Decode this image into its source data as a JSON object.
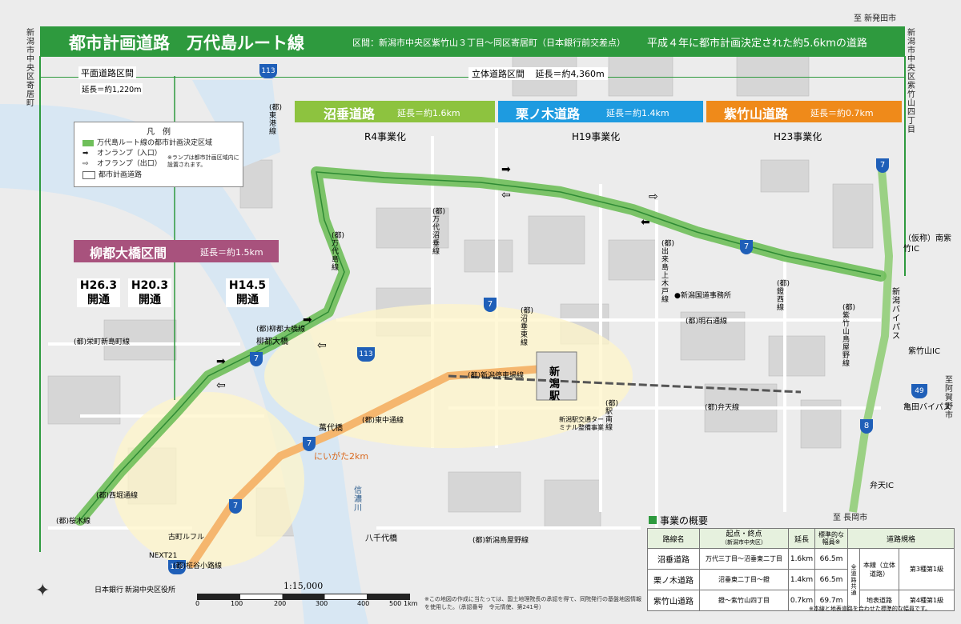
{
  "header": {
    "title": "都市計画道路　万代島ルート線",
    "section": "区間：新潟市中央区紫竹山３丁目〜同区寄居町（日本銀行前交差点）",
    "summary": "平成４年に都市計画決定された約5.6kmの道路"
  },
  "edges": {
    "left_top": "新潟市中央区寄居町",
    "right_top": "新潟市中央区紫竹山四丁目",
    "north_right": "至 新発田市",
    "south_exit": "至 長岡市",
    "east_exit": "至 阿賀野市"
  },
  "intervals": {
    "flat_label": "平面道路区間",
    "flat_length": "延長＝約1,220m",
    "elevated_label": "立体道路区間",
    "elevated_length": "延長＝約4,360m"
  },
  "sections": [
    {
      "name": "沼垂道路",
      "length": "延長＝約1.6km",
      "year": "R4事業化",
      "color": "#8dc33f"
    },
    {
      "name": "栗ノ木道路",
      "length": "延長＝約1.4km",
      "year": "H19事業化",
      "color": "#1e9be0"
    },
    {
      "name": "紫竹山道路",
      "length": "延長＝約0.7km",
      "year": "H23事業化",
      "color": "#ef8a1a"
    }
  ],
  "yanagi": {
    "name": "柳都大橋区間",
    "length": "延長＝約1.5km",
    "openings": [
      {
        "year": "H26.3",
        "status": "開通"
      },
      {
        "year": "H20.3",
        "status": "開通"
      },
      {
        "year": "H14.5",
        "status": "開通"
      }
    ]
  },
  "legend": {
    "title": "凡　例",
    "items": [
      "万代島ルート線の都市計画決定区域",
      "オンランプ（入口）",
      "オフランプ（出口）",
      "都市計画道路"
    ],
    "note": "※ランプは都市計画区域内に設置されます。"
  },
  "ics": [
    "（仮称）南紫竹IC",
    "紫竹山IC",
    "弁天IC"
  ],
  "places": {
    "station": "新潟駅",
    "river": "信濃川",
    "bridge_yachiyo": "八千代橋",
    "bridge_bandai": "萬代橋",
    "niigata2km": "にいがた2km",
    "bandai_bridge_label": "柳都大橋",
    "bypass_niigata": "新潟バイパス",
    "bypass_kameda": "亀田バイパス",
    "terminal": "新潟駅交通ターミナル整備事業",
    "office": "●新潟国道事務所",
    "nextz": "NEXT21",
    "furumachi": "古町ルフル",
    "bank": "日本銀行",
    "city_hall": "新潟中央区役所"
  },
  "roads": [
    "(都)東港線",
    "(都)万代沼垂線",
    "(都)沼垂東線",
    "(都)出来島上木戸線",
    "(都)明石通線",
    "(都)新潟停車場線",
    "(都)弁天線",
    "(都)柳都大橋線",
    "(都)東中通線",
    "(都)西堀通線",
    "(都)柾谷小路線",
    "(都)新潟鳥屋野線",
    "(都)駅南線",
    "(都)桜木線",
    "(都)万代島線",
    "(都)栄町新島町線",
    "(都)紫竹山鳥屋野線",
    "(都)鐙西線"
  ],
  "route_numbers": [
    "7",
    "113",
    "116",
    "8",
    "49"
  ],
  "scale": {
    "ratio": "1:15,000",
    "ticks": [
      "0",
      "100",
      "200",
      "300",
      "400",
      "500",
      "1km"
    ]
  },
  "credit": "※この地図の作成に当たっては、国土地理院長の承認を得て、同院発行の基盤地図情報を使用した。（承認番号　令元情使、第241号）",
  "overview": {
    "title": "事業の概要",
    "headers": [
      "路線名",
      "起点・終点",
      "延長",
      "標準的な幅員※",
      "道路規格"
    ],
    "start_end_sub": "（新潟市中央区）",
    "shared": "全道路共通",
    "rows": [
      {
        "name": "沼垂道路",
        "range": "万代三丁目〜沼垂東二丁目",
        "length": "1.6km",
        "width": "66.5m",
        "spec_kind": "本線（立体道路）",
        "spec_grade": "第3種第1級"
      },
      {
        "name": "栗ノ木道路",
        "range": "沼垂東二丁目〜鐙",
        "length": "1.4km",
        "width": "66.5m",
        "spec_kind": "",
        "spec_grade": ""
      },
      {
        "name": "紫竹山道路",
        "range": "鐙〜紫竹山四丁目",
        "length": "0.7km",
        "width": "69.7m",
        "spec_kind": "地表道路",
        "spec_grade": "第4種第1級"
      }
    ],
    "note": "※本線と地表道路を合わせた標準的な幅員です。"
  },
  "colors": {
    "header_green": "#2e9a3e",
    "route_green": "#6fbf5a",
    "yanagi_pink": "#a8527d",
    "road_orange": "#f5b66e",
    "river_blue": "#d8e7f3"
  }
}
